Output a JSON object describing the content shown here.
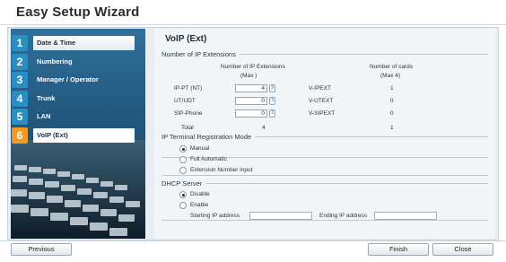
{
  "window": {
    "title": "Easy Setup Wizard"
  },
  "sidebar": {
    "items": [
      {
        "num": "1",
        "label": "Date & Time"
      },
      {
        "num": "2",
        "label": "Numbering"
      },
      {
        "num": "3",
        "label": "Manager / Operator"
      },
      {
        "num": "4",
        "label": "Trunk"
      },
      {
        "num": "5",
        "label": "LAN"
      },
      {
        "num": "6",
        "label": "VoIP (Ext)"
      }
    ]
  },
  "page": {
    "title": "VoIP (Ext)"
  },
  "ip_ext": {
    "legend": "Number of IP Extensions",
    "col_ext": "Number of IP Extensions",
    "col_ext_max": "(Max      )",
    "col_cards": "Number of cards",
    "col_cards_max": "(Max 4)",
    "rows": [
      {
        "label": "IP-PT (NT)",
        "value": "4",
        "card": "V-IPEXT",
        "cards": "1"
      },
      {
        "label": "UT/UDT",
        "value": "0",
        "card": "V-UTEXT",
        "cards": "0"
      },
      {
        "label": "SIP-Phone",
        "value": "0",
        "card": "V-SIPEXT",
        "cards": "0"
      }
    ],
    "total_label": "Total",
    "total_value": "4",
    "total_cards": "1"
  },
  "registration": {
    "legend": "IP Terminal Registration Mode",
    "options": [
      "Manual",
      "Full Automatic",
      "Extension Number input"
    ],
    "selected": "Manual"
  },
  "dhcp": {
    "legend": "DHCP Server",
    "options": [
      "Disable",
      "Enable"
    ],
    "selected": "Disable",
    "start_label": "Starting IP address",
    "end_label": "Ending IP address",
    "start_value": "",
    "end_value": ""
  },
  "footer": {
    "previous": "Previous",
    "finish": "Finish",
    "close": "Close"
  },
  "colors": {
    "accent": "#2a8ec2",
    "active_step": "#f29a1f"
  }
}
